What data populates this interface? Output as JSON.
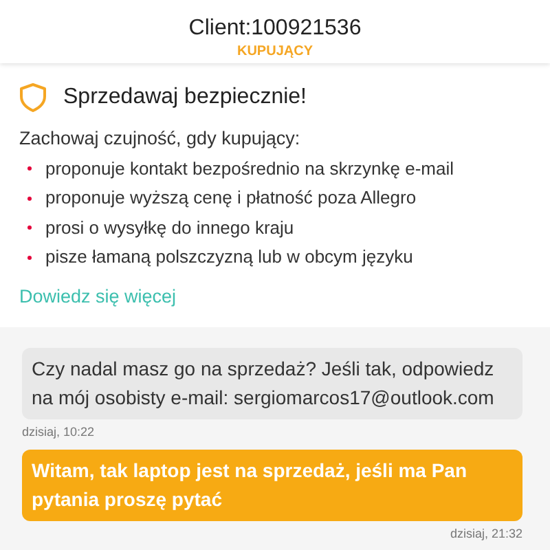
{
  "header": {
    "title": "Client:100921536",
    "role": "KUPUJĄCY"
  },
  "safety": {
    "title": "Sprzedawaj bezpiecznie!",
    "intro": "Zachowaj czujność, gdy kupujący:",
    "items": [
      "proponuje kontakt bezpośrednio na skrzynkę e-mail",
      "proponuje wyższą cenę i płatność poza Allegro",
      "prosi o wysyłkę do innego kraju",
      "pisze łamaną polszczyzną lub w obcym języku"
    ],
    "link": "Dowiedz się więcej"
  },
  "messages": [
    {
      "kind": "incoming",
      "text": "Czy nadal masz go na sprzedaż? Jeśli tak, odpowiedz na mój osobisty e-mail: sergiomarcos17@outlook.com",
      "time": "dzisiaj, 10:22"
    },
    {
      "kind": "outgoing",
      "text": "Witam, tak laptop jest na sprzedaż, jeśli ma Pan pytania proszę pytać",
      "time": "dzisiaj, 21:32"
    }
  ]
}
